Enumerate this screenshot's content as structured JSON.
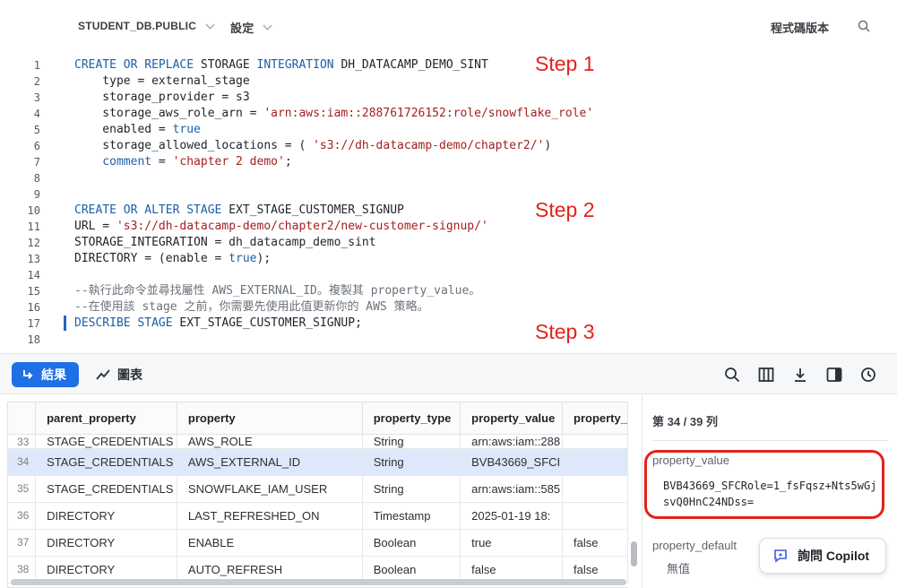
{
  "toolbar": {
    "database": "STUDENT_DB.PUBLIC",
    "settings": "設定",
    "versions": "程式碼版本"
  },
  "editor": {
    "lines": [
      {
        "n": "1",
        "parts": [
          [
            "kw",
            "CREATE OR REPLACE "
          ],
          [
            "",
            "STORAGE "
          ],
          [
            "kw",
            "INTEGRATION "
          ],
          [
            "",
            "DH_DATACAMP_DEMO_SINT"
          ]
        ]
      },
      {
        "n": "2",
        "parts": [
          [
            "",
            "    type = external_stage"
          ]
        ]
      },
      {
        "n": "3",
        "parts": [
          [
            "",
            "    storage_provider = s3"
          ]
        ]
      },
      {
        "n": "4",
        "parts": [
          [
            "",
            "    storage_aws_role_arn = "
          ],
          [
            "str",
            "'arn:aws:iam::288761726152:role/snowflake_role'"
          ]
        ]
      },
      {
        "n": "5",
        "parts": [
          [
            "",
            "    enabled = "
          ],
          [
            "bool",
            "true"
          ]
        ]
      },
      {
        "n": "6",
        "parts": [
          [
            "",
            "    storage_allowed_locations = ( "
          ],
          [
            "str",
            "'s3://dh-datacamp-demo/chapter2/'"
          ],
          [
            "",
            ")"
          ]
        ]
      },
      {
        "n": "7",
        "parts": [
          [
            "kw",
            "    comment "
          ],
          [
            "",
            "= "
          ],
          [
            "str",
            "'chapter 2 demo'"
          ],
          [
            "",
            ";"
          ]
        ]
      },
      {
        "n": "8",
        "parts": []
      },
      {
        "n": "9",
        "parts": []
      },
      {
        "n": "10",
        "parts": [
          [
            "kw",
            "CREATE OR ALTER STAGE "
          ],
          [
            "",
            "EXT_STAGE_CUSTOMER_SIGNUP"
          ]
        ]
      },
      {
        "n": "11",
        "parts": [
          [
            "",
            "URL = "
          ],
          [
            "str",
            "'s3://dh-datacamp-demo/chapter2/new-customer-signup/'"
          ]
        ]
      },
      {
        "n": "12",
        "parts": [
          [
            "",
            "STORAGE_INTEGRATION = dh_datacamp_demo_sint"
          ]
        ]
      },
      {
        "n": "13",
        "parts": [
          [
            "",
            "DIRECTORY = (enable = "
          ],
          [
            "bool",
            "true"
          ],
          [
            "",
            ");"
          ]
        ]
      },
      {
        "n": "14",
        "parts": []
      },
      {
        "n": "15",
        "parts": [
          [
            "cm",
            "--執行此命令並尋找屬性 AWS_EXTERNAL_ID。複製其 property_value。"
          ]
        ]
      },
      {
        "n": "16",
        "parts": [
          [
            "cm",
            "--在使用該 stage 之前，你需要先使用此值更新你的 AWS 策略。"
          ]
        ]
      },
      {
        "n": "17",
        "parts": [
          [
            "kw",
            "DESCRIBE STAGE "
          ],
          [
            "",
            "EXT_STAGE_CUSTOMER_SIGNUP;"
          ]
        ]
      },
      {
        "n": "18",
        "parts": []
      }
    ],
    "steps": [
      "Step 1",
      "Step 2",
      "Step 3"
    ]
  },
  "results": {
    "tab_results": "結果",
    "tab_chart": "圖表",
    "columns": [
      "",
      "parent_property",
      "property",
      "property_type",
      "property_value",
      "property_"
    ],
    "rows": [
      [
        "33",
        "STAGE_CREDENTIALS",
        "AWS_ROLE",
        "String",
        "arn:aws:iam::288",
        ""
      ],
      [
        "34",
        "STAGE_CREDENTIALS",
        "AWS_EXTERNAL_ID",
        "String",
        "BVB43669_SFCI",
        ""
      ],
      [
        "35",
        "STAGE_CREDENTIALS",
        "SNOWFLAKE_IAM_USER",
        "String",
        "arn:aws:iam::585",
        ""
      ],
      [
        "36",
        "DIRECTORY",
        "LAST_REFRESHED_ON",
        "Timestamp",
        "2025-01-19 18:",
        ""
      ],
      [
        "37",
        "DIRECTORY",
        "ENABLE",
        "Boolean",
        "true",
        "false"
      ],
      [
        "38",
        "DIRECTORY",
        "AUTO_REFRESH",
        "Boolean",
        "false",
        "false"
      ]
    ],
    "selected_row": 1
  },
  "detail": {
    "row_count": "第 34 / 39 列",
    "property_value_label": "property_value",
    "property_value": "BVB43669_SFCRole=1_fsFqsz+Nts5wGjsvQ0HnC24NDss=",
    "property_default_label": "property_default",
    "property_default_value": "無值",
    "copilot": "詢問 Copilot"
  },
  "colors": {
    "accent": "#1f6fe5",
    "annotation": "#e3231b",
    "selected_row": "#dde8fb"
  }
}
